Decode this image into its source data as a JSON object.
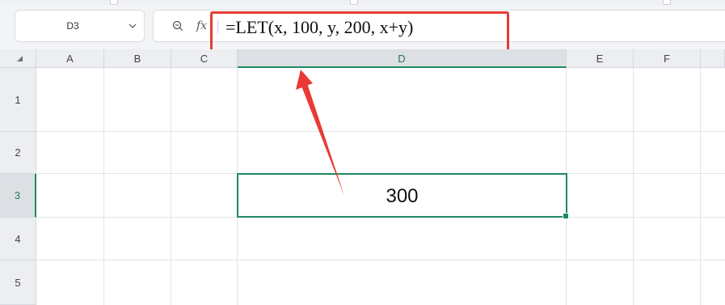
{
  "name_box": {
    "value": "D3"
  },
  "formula_bar": {
    "fx_label": "fx",
    "formula": "=LET(x, 100, y, 200, x+y)"
  },
  "sheet": {
    "columns": [
      "A",
      "B",
      "C",
      "D",
      "E",
      "F"
    ],
    "rows": [
      "1",
      "2",
      "3",
      "4",
      "5"
    ],
    "active_column": "D",
    "active_row": "3",
    "active_cell_value": "300"
  },
  "colors": {
    "annotation": "#ea3a35",
    "selection": "#1e8a61"
  },
  "icons": [
    "chevron-down-icon",
    "zoom-icon",
    "fx-icon",
    "select-all-icon"
  ]
}
